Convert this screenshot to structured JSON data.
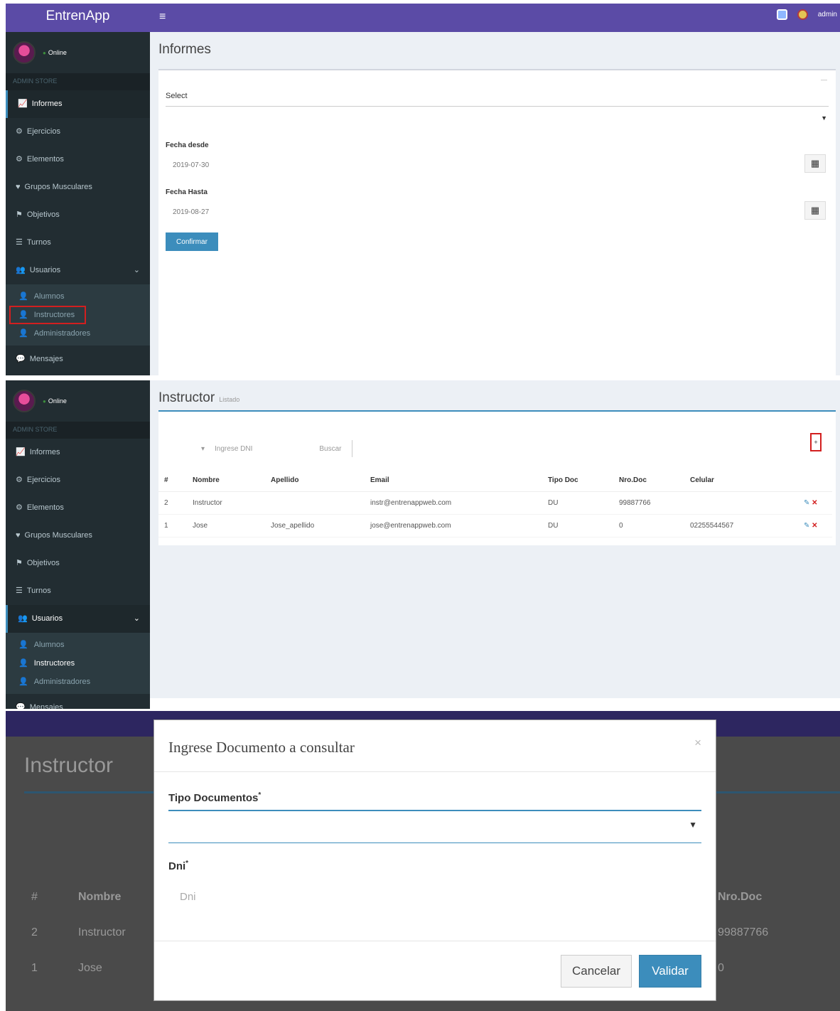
{
  "app": {
    "brand": "EntrenApp",
    "menu_icon": "≡",
    "user_name": "admin"
  },
  "sidebar": {
    "status": "Online",
    "section": "ADMIN STORE",
    "items": [
      "Informes",
      "Ejercicios",
      "Elementos",
      "Grupos Musculares",
      "Objetivos",
      "Turnos",
      "Usuarios"
    ],
    "sub_items": [
      "Alumnos",
      "Instructores",
      "Administradores"
    ],
    "footer_item": "Mensajes"
  },
  "informes": {
    "title": "Informes",
    "select_label": "Select",
    "fecha_desde_label": "Fecha desde",
    "fecha_desde_value": "2019-07-30",
    "fecha_hasta_label": "Fecha Hasta",
    "fecha_hasta_value": "2019-08-27",
    "confirm_label": "Confirmar"
  },
  "instructor": {
    "title": "Instructor",
    "subtitle": "Listado",
    "search_placeholder": "Ingrese DNI",
    "search_button": "Buscar",
    "columns": [
      "#",
      "Nombre",
      "Apellido",
      "Email",
      "Tipo Doc",
      "Nro.Doc",
      "Celular"
    ],
    "rows": [
      [
        "2",
        "Instructor",
        "",
        "instr@entrenappweb.com",
        "DU",
        "99887766",
        ""
      ],
      [
        "1",
        "Jose",
        "Jose_apellido",
        "jose@entrenappweb.com",
        "DU",
        "0",
        "02255544567"
      ]
    ]
  },
  "modal": {
    "title": "Ingrese Documento a consultar",
    "tipo_label": "Tipo Documentos",
    "dni_label": "Dni",
    "dni_placeholder": "Dni",
    "cancel": "Cancelar",
    "validate": "Validar",
    "bg_title": "Instructor",
    "bg_cols": [
      "#",
      "Nombre",
      "Nro.Doc"
    ],
    "bg_rows": [
      [
        "2",
        "Instructor",
        "99887766"
      ],
      [
        "1",
        "Jose",
        "0"
      ]
    ]
  }
}
